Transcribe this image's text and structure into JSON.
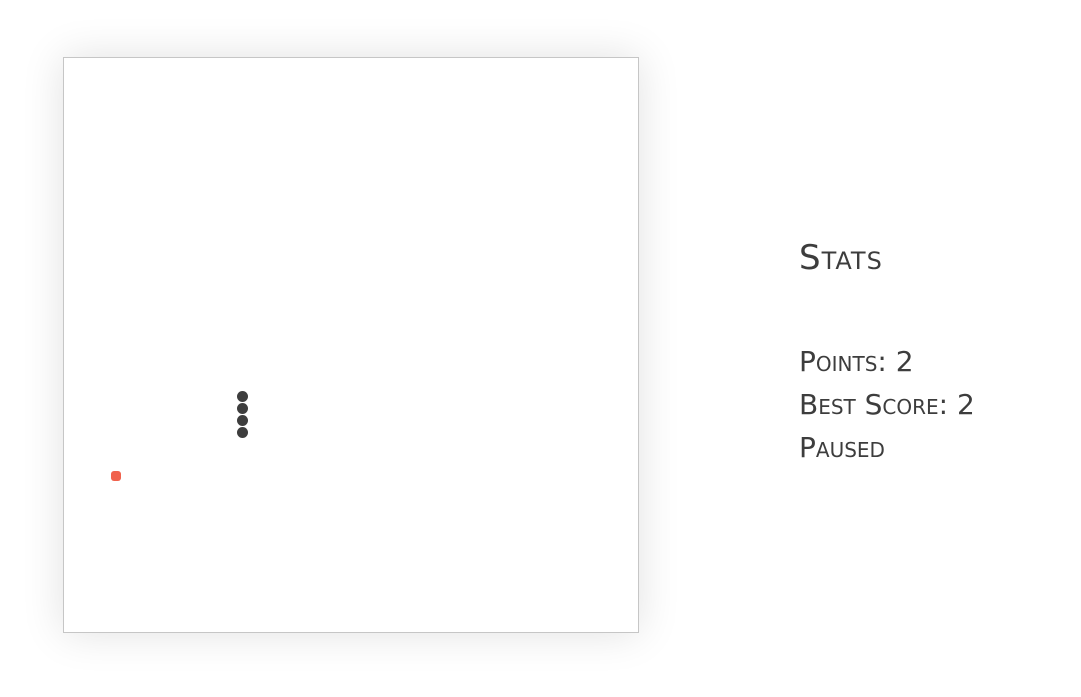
{
  "stats": {
    "title": "Stats",
    "points_label": "Points:",
    "points": "2",
    "best_score_label": "Best Score:",
    "best_score": "2",
    "status": "Paused"
  },
  "colors": {
    "snake": "#3d3d3d",
    "food": "#f0624d",
    "board_border": "#c6c6c6"
  }
}
